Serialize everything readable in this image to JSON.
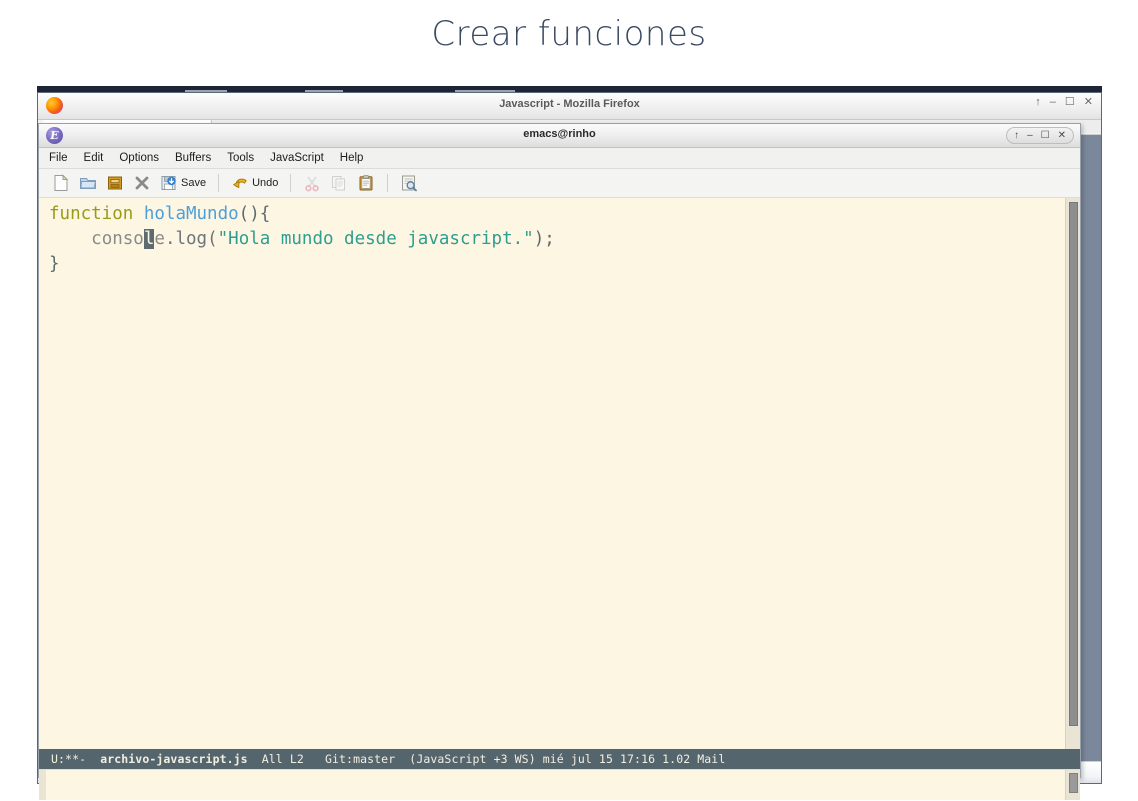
{
  "slide": {
    "title": "Crear funciones",
    "title_color": "#3b4a63",
    "background": "#ffffff"
  },
  "firefox_window": {
    "title": "Javascript - Mozilla Firefox",
    "logo_icon": "firefox-logo-icon",
    "window_buttons": [
      {
        "name": "shade-button",
        "glyph": "↑"
      },
      {
        "name": "minimize-button",
        "glyph": "–"
      },
      {
        "name": "maximize-button",
        "glyph": "☐"
      },
      {
        "name": "close-button",
        "glyph": "✕"
      }
    ],
    "tab_accent_color": "#2b7fd4"
  },
  "emacs_window": {
    "title": "emacs@rinho",
    "logo_icon": "emacs-logo-icon",
    "logo_letter": "E",
    "window_buttons": [
      {
        "name": "shade-button",
        "glyph": "↑"
      },
      {
        "name": "minimize-button",
        "glyph": "–"
      },
      {
        "name": "maximize-button",
        "glyph": "☐"
      },
      {
        "name": "close-button",
        "glyph": "✕"
      }
    ],
    "menubar": [
      {
        "name": "menu-file",
        "label": "File"
      },
      {
        "name": "menu-edit",
        "label": "Edit"
      },
      {
        "name": "menu-options",
        "label": "Options"
      },
      {
        "name": "menu-buffers",
        "label": "Buffers"
      },
      {
        "name": "menu-tools",
        "label": "Tools"
      },
      {
        "name": "menu-javascript",
        "label": "JavaScript"
      },
      {
        "name": "menu-help",
        "label": "Help"
      }
    ],
    "toolbar": [
      {
        "name": "new-file-button",
        "icon": "new-document-icon",
        "label": ""
      },
      {
        "name": "open-file-button",
        "icon": "open-folder-icon",
        "label": ""
      },
      {
        "name": "save-as-button",
        "icon": "save-box-icon",
        "label": ""
      },
      {
        "name": "close-buffer-button",
        "icon": "close-x-icon",
        "label": ""
      },
      {
        "name": "save-button",
        "icon": "save-disk-icon",
        "label": "Save"
      },
      {
        "name": "undo-button",
        "icon": "undo-arrow-icon",
        "label": "Undo"
      },
      {
        "name": "cut-button",
        "icon": "scissors-icon",
        "label": ""
      },
      {
        "name": "copy-button",
        "icon": "copy-pages-icon",
        "label": ""
      },
      {
        "name": "paste-button",
        "icon": "clipboard-icon",
        "label": ""
      },
      {
        "name": "search-button",
        "icon": "search-page-icon",
        "label": ""
      }
    ],
    "buffer": {
      "background": "#fdf6e3",
      "code_lines": [
        {
          "tokens": [
            {
              "text": "function",
              "type": "keyword"
            },
            {
              "text": " ",
              "type": "plain"
            },
            {
              "text": "holaMundo",
              "type": "function-name"
            },
            {
              "text": "(){",
              "type": "punctuation"
            }
          ]
        },
        {
          "tokens": [
            {
              "text": "    ",
              "type": "plain"
            },
            {
              "text": "conso",
              "type": "object"
            },
            {
              "text": "l",
              "type": "cursor"
            },
            {
              "text": "e",
              "type": "object"
            },
            {
              "text": ".log(",
              "type": "property"
            },
            {
              "text": "\"Hola mundo desde javascript.\"",
              "type": "string"
            },
            {
              "text": ");",
              "type": "punctuation"
            }
          ]
        },
        {
          "tokens": [
            {
              "text": "}",
              "type": "punctuation"
            }
          ]
        }
      ],
      "syntax_colors": {
        "keyword": "#9a9a18",
        "function_name": "#4d9fd8",
        "punctuation": "#5d6a70",
        "object": "#8a8a8a",
        "property": "#6c757a",
        "string": "#2d9e8f",
        "cursor_background": "#5d6a70"
      }
    },
    "modeline": {
      "status": "U:**-",
      "buffer_name": "archivo-javascript.js",
      "position": "All L2",
      "vc": "Git:master",
      "mode_info": "(JavaScript +3 WS) mié jul 15 17:16 1.02 Mail",
      "background": "#55656e",
      "foreground": "#f3efe0"
    },
    "minibuffer": {
      "text": ""
    }
  }
}
